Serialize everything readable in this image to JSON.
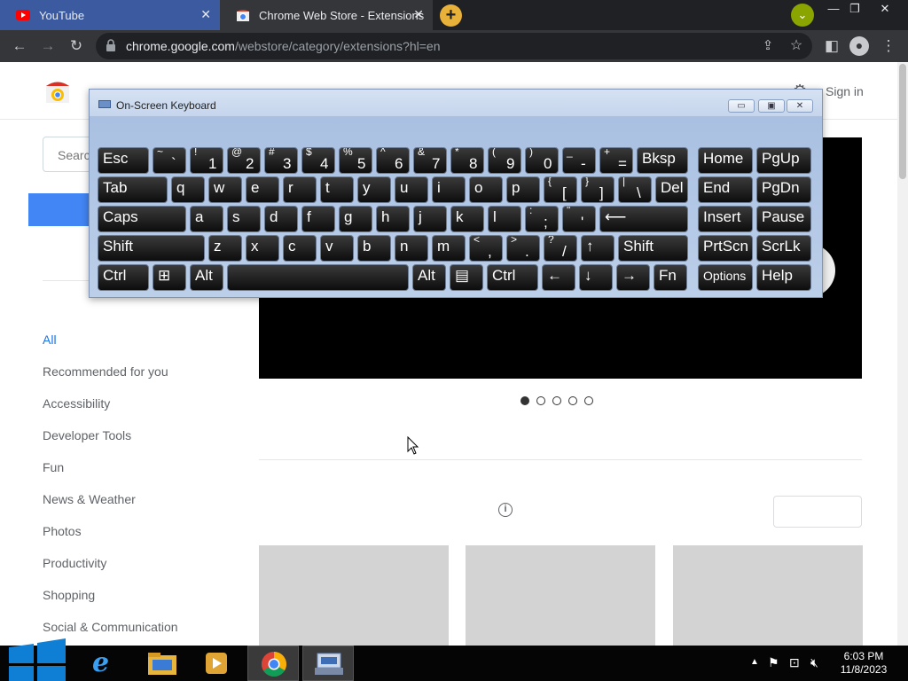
{
  "browser": {
    "tabs": [
      {
        "label": "YouTube",
        "active": false
      },
      {
        "label": "Chrome Web Store - Extensions",
        "active": true
      }
    ],
    "tab_close": "✕",
    "new_tab": "+",
    "url_host": "chrome.google.com",
    "url_path": "/webstore/category/extensions?hl=en",
    "accent_colors": {
      "youtube": "#ff0000",
      "tabbar": "#202124",
      "toolbar": "#35363a"
    }
  },
  "page": {
    "sign_in": "Sign in",
    "search_placeholder": "Search",
    "categories": [
      "All",
      "Recommended for you",
      "Accessibility",
      "Developer Tools",
      "Fun",
      "News & Weather",
      "Photos",
      "Productivity",
      "Shopping",
      "Social & Communication"
    ],
    "selected_category": "All",
    "carousel_dots": 5,
    "carousel_active": 1,
    "info_glyph": "i"
  },
  "osk": {
    "title": "On-Screen Keyboard",
    "rows": [
      [
        {
          "l": "Esc"
        },
        {
          "s": "~",
          "m": "`"
        },
        {
          "s": "!",
          "m": "1"
        },
        {
          "s": "@",
          "m": "2"
        },
        {
          "s": "#",
          "m": "3"
        },
        {
          "s": "$",
          "m": "4"
        },
        {
          "s": "%",
          "m": "5"
        },
        {
          "s": "^",
          "m": "6"
        },
        {
          "s": "&",
          "m": "7"
        },
        {
          "s": "*",
          "m": "8"
        },
        {
          "s": "(",
          "m": "9"
        },
        {
          "s": ")",
          "m": "0"
        },
        {
          "s": "_",
          "m": "-"
        },
        {
          "s": "+",
          "m": "="
        },
        {
          "l": "Bksp"
        },
        {
          "l": "Home"
        },
        {
          "l": "PgUp"
        }
      ],
      [
        {
          "l": "Tab"
        },
        {
          "l": "q"
        },
        {
          "l": "w"
        },
        {
          "l": "e"
        },
        {
          "l": "r"
        },
        {
          "l": "t"
        },
        {
          "l": "y"
        },
        {
          "l": "u"
        },
        {
          "l": "i"
        },
        {
          "l": "o"
        },
        {
          "l": "p"
        },
        {
          "s": "{",
          "m": "["
        },
        {
          "s": "}",
          "m": "]"
        },
        {
          "s": "|",
          "m": "\\"
        },
        {
          "l": "Del"
        },
        {
          "l": "End"
        },
        {
          "l": "PgDn"
        }
      ],
      [
        {
          "l": "Caps"
        },
        {
          "l": "a"
        },
        {
          "l": "s"
        },
        {
          "l": "d"
        },
        {
          "l": "f"
        },
        {
          "l": "g"
        },
        {
          "l": "h"
        },
        {
          "l": "j"
        },
        {
          "l": "k"
        },
        {
          "l": "l"
        },
        {
          "s": ":",
          "m": ";"
        },
        {
          "s": "\"",
          "m": "'"
        },
        {
          "l": "⟵"
        },
        {
          "l": "Insert"
        },
        {
          "l": "Pause"
        }
      ],
      [
        {
          "l": "Shift"
        },
        {
          "l": "z"
        },
        {
          "l": "x"
        },
        {
          "l": "c"
        },
        {
          "l": "v"
        },
        {
          "l": "b"
        },
        {
          "l": "n"
        },
        {
          "l": "m"
        },
        {
          "s": "<",
          "m": ","
        },
        {
          "s": ">",
          "m": "."
        },
        {
          "s": "?",
          "m": "/"
        },
        {
          "l": "↑"
        },
        {
          "l": "Shift"
        },
        {
          "l": "PrtScn"
        },
        {
          "l": "ScrLk"
        }
      ],
      [
        {
          "l": "Ctrl"
        },
        {
          "l": "⊞"
        },
        {
          "l": "Alt"
        },
        {
          "l": ""
        },
        {
          "l": "Alt"
        },
        {
          "l": "▤"
        },
        {
          "l": "Ctrl"
        },
        {
          "l": "←"
        },
        {
          "l": "↓"
        },
        {
          "l": "→"
        },
        {
          "l": "Fn"
        },
        {
          "l": "Options"
        },
        {
          "l": "Help"
        }
      ]
    ]
  },
  "taskbar": {
    "time": "6:03 PM",
    "date": "11/8/2023",
    "apps": [
      "internet-explorer",
      "file-explorer",
      "media-player",
      "chrome",
      "on-screen-keyboard"
    ]
  }
}
